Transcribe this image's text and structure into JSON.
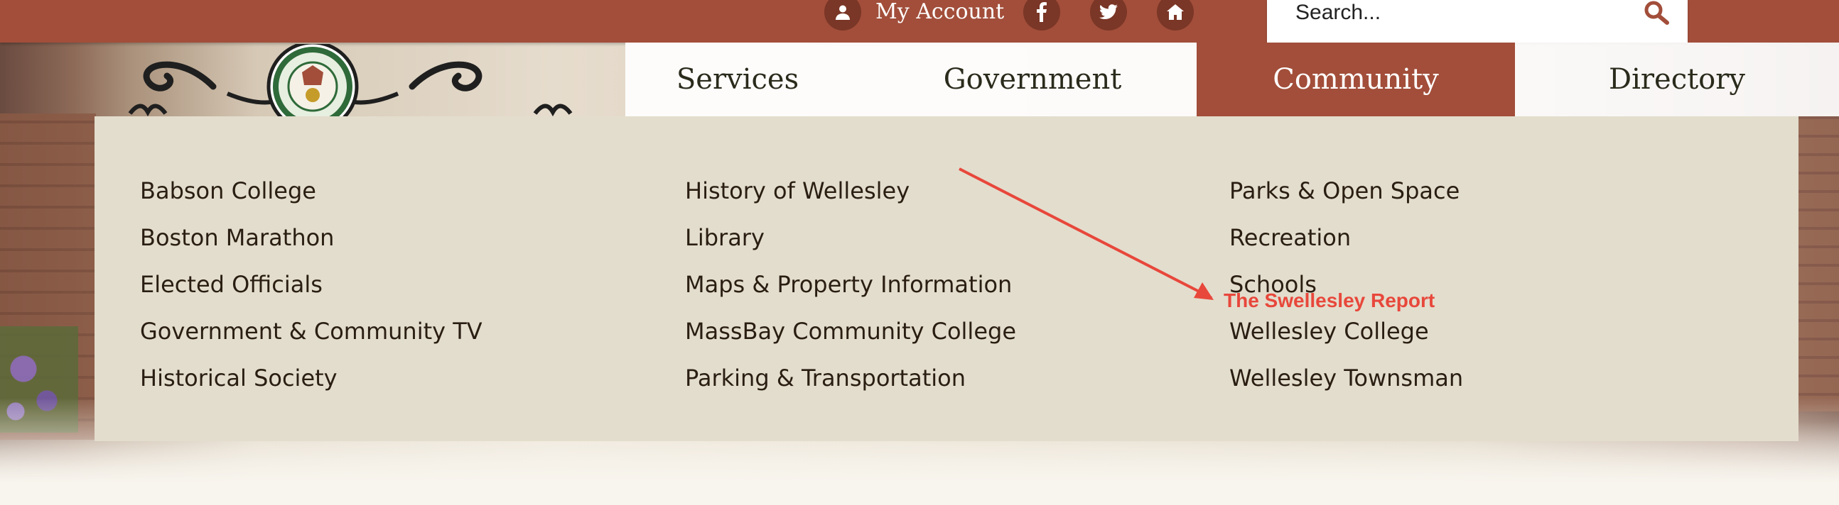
{
  "top_bar": {
    "my_account_label": "My Account",
    "search_placeholder": "Search...",
    "icons": [
      "user-icon",
      "facebook-icon",
      "twitter-icon",
      "home-icon",
      "search-icon"
    ],
    "brand_color": "#a24e3a"
  },
  "main_nav": {
    "items": [
      {
        "label": "Services",
        "active": false
      },
      {
        "label": "Government",
        "active": false
      },
      {
        "label": "Community",
        "active": true
      },
      {
        "label": "Directory",
        "active": false
      }
    ]
  },
  "dropdown": {
    "columns": [
      [
        "Babson College",
        "Boston Marathon",
        "Elected Officials",
        "Government & Community TV",
        "Historical Society"
      ],
      [
        "History of Wellesley",
        "Library",
        "Maps & Property Information",
        "MassBay Community College",
        "Parking & Transportation"
      ],
      [
        "Parks & Open Space",
        "Recreation",
        "Schools",
        "Wellesley College",
        "Wellesley Townsman"
      ]
    ],
    "background_color": "#e3ddcd"
  },
  "annotation": {
    "text": "The Swellesley Report",
    "color": "#e8473b"
  }
}
